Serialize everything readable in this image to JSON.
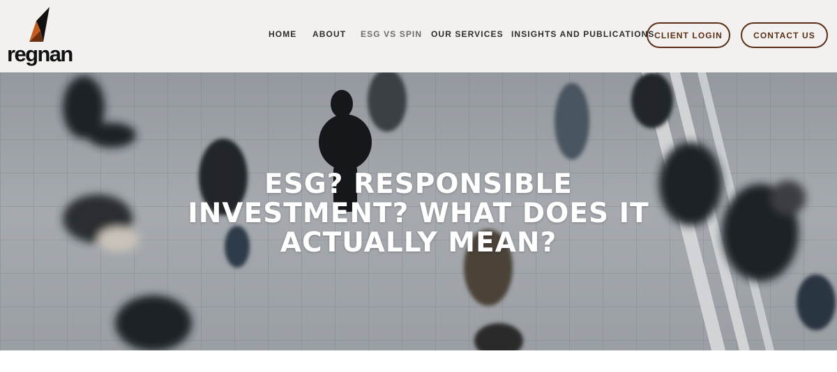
{
  "brand": {
    "name": "regnan"
  },
  "nav": {
    "items": [
      {
        "label": "HOME"
      },
      {
        "label": "ABOUT"
      },
      {
        "label": "ESG VS SPIN"
      },
      {
        "label": "OUR SERVICES"
      },
      {
        "label": "INSIGHTS AND PUBLICATIONS"
      }
    ],
    "active": "ESG VS SPIN",
    "client_login": "CLIENT LOGIN",
    "contact": "CONTACT US"
  },
  "hero": {
    "title": "ESG? RESPONSIBLE INVESTMENT? WHAT DOES IT ACTUALLY MEAN?"
  },
  "colors": {
    "header_bg": "#f3f1ef",
    "accent": "#5a2e16",
    "logo_orange": "#c55a1b",
    "text_dark": "#2b2b2b"
  }
}
